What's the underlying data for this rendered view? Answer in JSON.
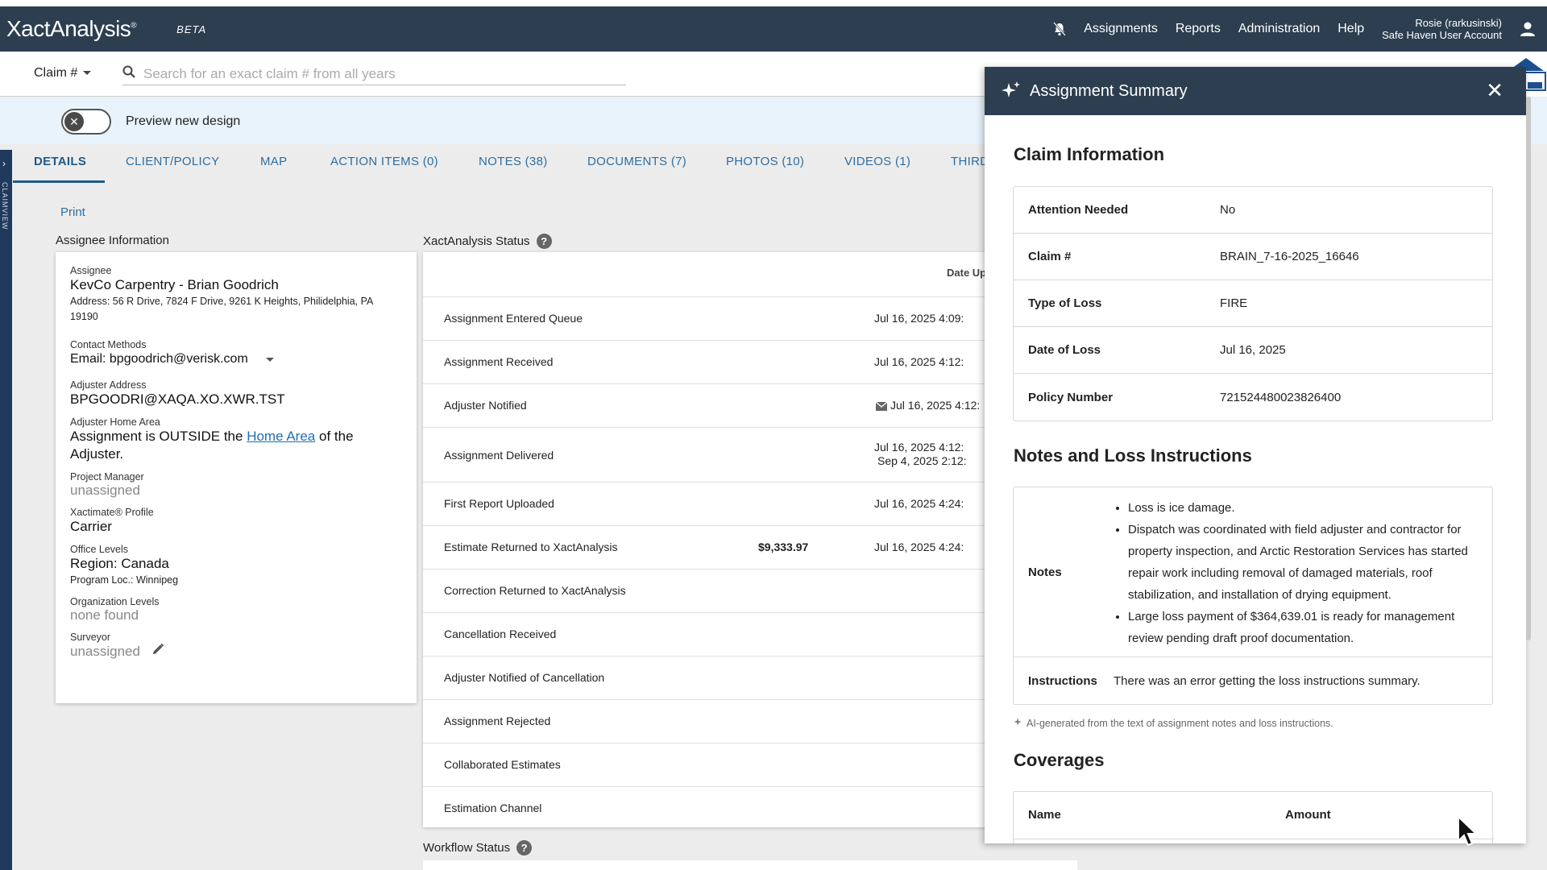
{
  "app": {
    "brand": "XactAnalysis",
    "brand_mark": "®",
    "beta": "BETA",
    "nav": [
      "Assignments",
      "Reports",
      "Administration",
      "Help"
    ],
    "user_name": "Rosie (rarkusinski)",
    "user_account": "Safe Haven User Account"
  },
  "search": {
    "type_label": "Claim #",
    "placeholder": "Search for an exact claim # from all years"
  },
  "preview": {
    "label": "Preview new design"
  },
  "tabs": [
    "DETAILS",
    "CLIENT/POLICY",
    "MAP",
    "ACTION ITEMS (0)",
    "NOTES (38)",
    "DOCUMENTS (7)",
    "PHOTOS (10)",
    "VIDEOS (1)",
    "THIRD"
  ],
  "sidestrip_text": "CLAIMVIEW",
  "print_label": "Print",
  "assignee": {
    "section_title": "Assignee Information",
    "assignee_label": "Assignee",
    "assignee_name": "KevCo Carpentry - Brian Goodrich",
    "address": "Address: 56 R Drive, 7824 F Drive, 9261 K Heights, Philidelphia, PA 19190",
    "contact_label": "Contact Methods",
    "contact_value": "Email: bpgoodrich@verisk.com",
    "adjuster_address_label": "Adjuster Address",
    "adjuster_address": "BPGOODRI@XAQA.XO.XWR.TST",
    "home_area_label": "Adjuster Home Area",
    "home_area_pre": "Assignment is OUTSIDE the",
    "home_area_link": "Home Area",
    "home_area_post": "of the Adjuster.",
    "pm_label": "Project Manager",
    "pm_value": "unassigned",
    "profile_label": "Xactimate® Profile",
    "profile_value": "Carrier",
    "office_label": "Office Levels",
    "office_value": "Region: Canada",
    "program_loc": "Program Loc.: Winnipeg",
    "org_label": "Organization Levels",
    "org_value": "none found",
    "surveyor_label": "Surveyor",
    "surveyor_value": "unassigned"
  },
  "status": {
    "section_title": "XactAnalysis Status",
    "date_header": "Date Up",
    "rows": [
      {
        "name": "Assignment Entered Queue",
        "amount": "",
        "date": "Jul 16, 2025 4:09:"
      },
      {
        "name": "Assignment Received",
        "amount": "",
        "date": "Jul 16, 2025 4:12:"
      },
      {
        "name": "Adjuster Notified",
        "amount": "",
        "date": "Jul 16, 2025 4:12:"
      },
      {
        "name": "Assignment Delivered",
        "amount": "",
        "date": "Jul 16, 2025 4:12:",
        "date2": "Sep 4, 2025 2:12:"
      },
      {
        "name": "First Report Uploaded",
        "amount": "",
        "date": "Jul 16, 2025 4:24:"
      },
      {
        "name": "Estimate Returned to XactAnalysis",
        "amount": "$9,333.97",
        "date": "Jul 16, 2025 4:24:"
      },
      {
        "name": "Correction Returned to XactAnalysis",
        "amount": "",
        "date": ""
      },
      {
        "name": "Cancellation Received",
        "amount": "",
        "date": ""
      },
      {
        "name": "Adjuster Notified of Cancellation",
        "amount": "",
        "date": ""
      },
      {
        "name": "Assignment Rejected",
        "amount": "",
        "date": ""
      },
      {
        "name": "Collaborated Estimates",
        "amount": "",
        "date": ""
      },
      {
        "name": "Estimation Channel",
        "amount": "",
        "date": ""
      }
    ]
  },
  "workflow": {
    "section_title": "Workflow Status"
  },
  "summary": {
    "title": "Assignment Summary",
    "claim_info_title": "Claim Information",
    "claim_rows": [
      {
        "k": "Attention Needed",
        "v": "No"
      },
      {
        "k": "Claim #",
        "v": "BRAIN_7-16-2025_16646"
      },
      {
        "k": "Type of Loss",
        "v": "FIRE"
      },
      {
        "k": "Date of Loss",
        "v": "Jul 16, 2025"
      },
      {
        "k": "Policy Number",
        "v": "721524480023826400"
      }
    ],
    "notes_title": "Notes and Loss Instructions",
    "notes_label": "Notes",
    "notes": [
      "Loss is ice damage.",
      "Dispatch was coordinated with field adjuster and contractor for property inspection, and Arctic Restoration Services has started repair work including removal of damaged materials, roof stabilization, and installation of drying equipment.",
      "Large loss payment of $364,639.01 is ready for management review pending draft proof documentation."
    ],
    "instructions_label": "Instructions",
    "instructions": "There was an error getting the loss instructions summary.",
    "ai_footnote": "AI-generated from the text of assignment notes and loss instructions.",
    "coverages_title": "Coverages",
    "cov_name": "Name",
    "cov_amount": "Amount"
  }
}
